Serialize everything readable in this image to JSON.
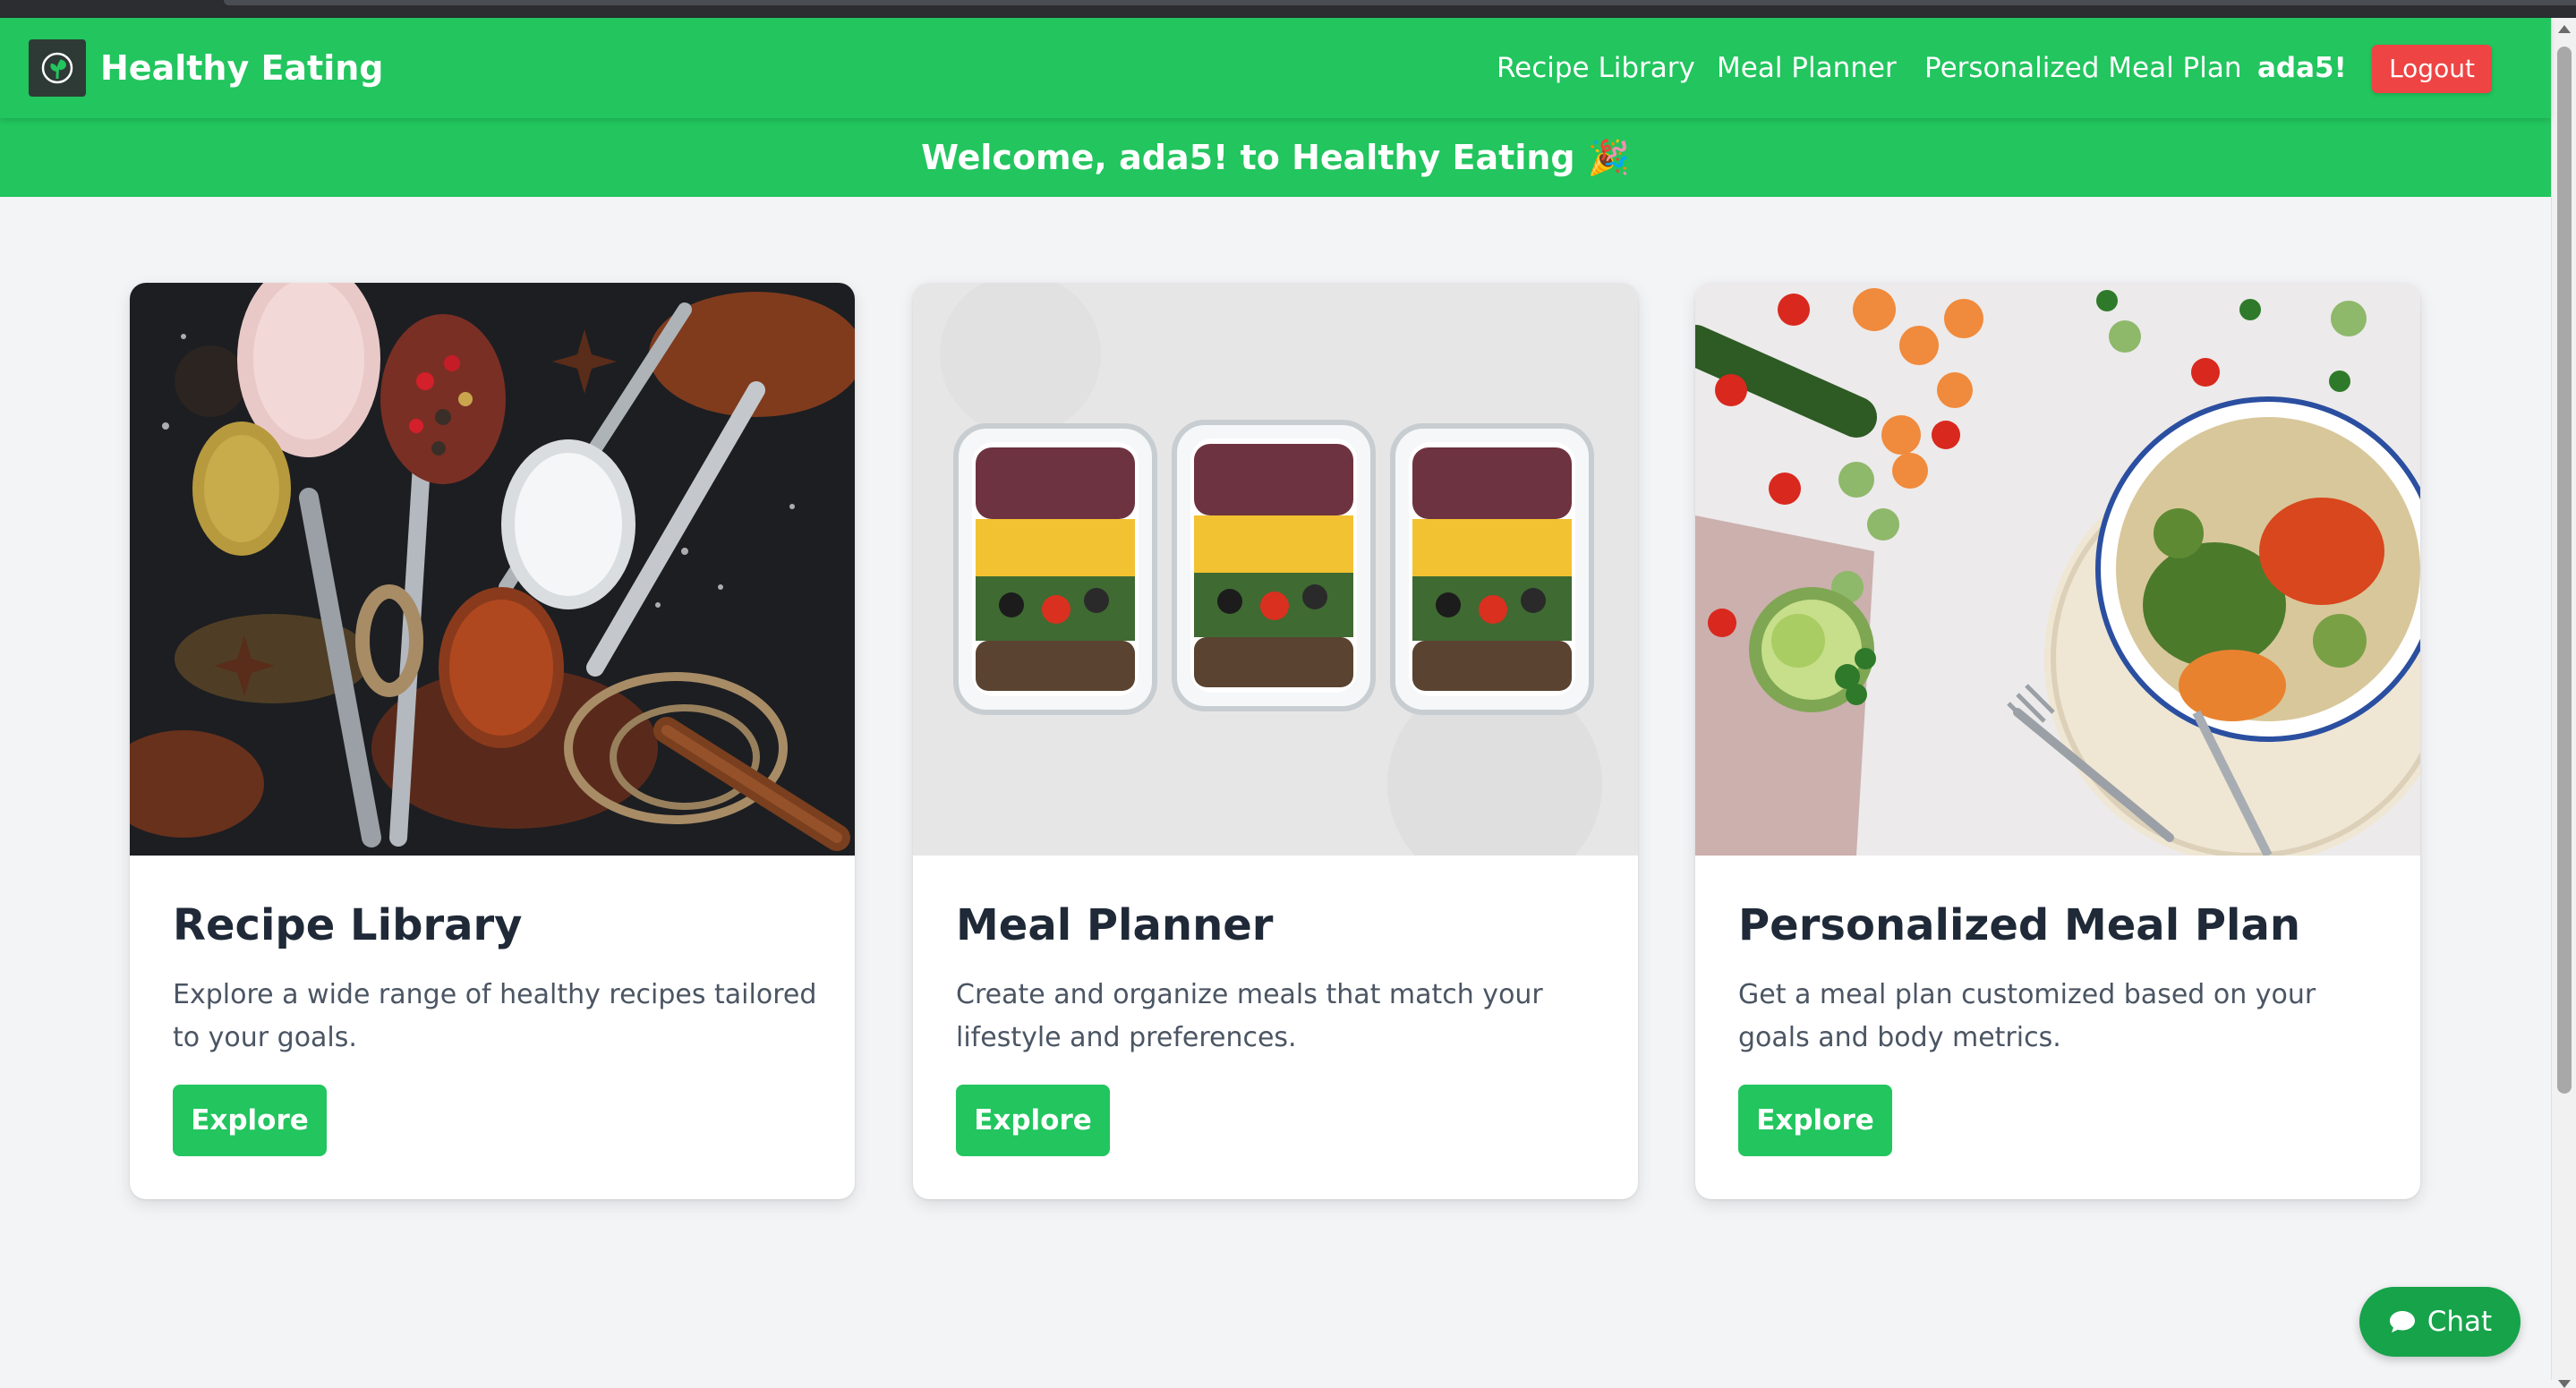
{
  "navbar": {
    "brand": "Healthy Eating",
    "links": [
      "Recipe Library",
      "Meal Planner",
      "Personalized Meal Plan"
    ],
    "username": "ada5!",
    "logout_label": "Logout"
  },
  "welcome": {
    "prefix": "Welcome, ",
    "username": "ada5",
    "suffix": "! to Healthy Eating",
    "emoji": "🎉"
  },
  "cards": [
    {
      "title": "Recipe Library",
      "description": "Explore a wide range of healthy recipes tailored to your goals.",
      "button": "Explore",
      "image": "spices-on-spoons-photo"
    },
    {
      "title": "Meal Planner",
      "description": "Create and organize meals that match your lifestyle and preferences.",
      "button": "Explore",
      "image": "meal-prep-containers-photo"
    },
    {
      "title": "Personalized Meal Plan",
      "description": "Get a meal plan customized based on your goals and body metrics.",
      "button": "Explore",
      "image": "vegetable-bowl-photo"
    }
  ],
  "chat": {
    "label": "Chat",
    "icon": "chat-bubble-icon"
  },
  "colors": {
    "brand": "#22c55e",
    "logout": "#ef4444",
    "background": "#f3f4f6"
  }
}
